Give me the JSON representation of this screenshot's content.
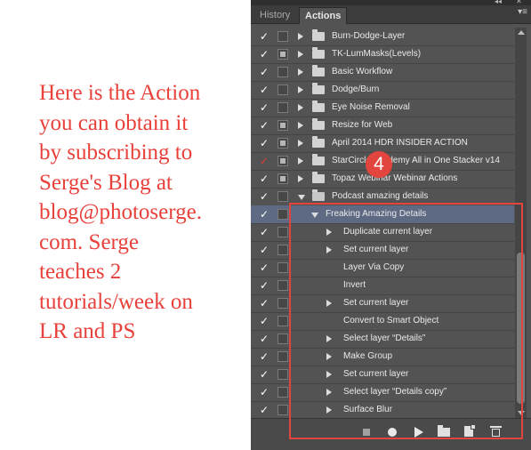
{
  "caption": {
    "lines": [
      "Here is the Action",
      "you can obtain it",
      "by subscribing to",
      "Serge's Blog at",
      "blog@photoserge.",
      "com.  Serge",
      "teaches 2",
      "tutorials/week on",
      "LR and PS"
    ]
  },
  "panel": {
    "collapse_glyph": "◂◂",
    "close_glyph": "✕",
    "tabs": [
      {
        "label": "History",
        "active": false
      },
      {
        "label": "Actions",
        "active": true
      }
    ],
    "menu_glyph": "▾≡"
  },
  "actions": [
    {
      "label": "Burn-Dodge-Layer",
      "check": "✓",
      "dialog": false,
      "type": "set",
      "expanded": false
    },
    {
      "label": "TK-LumMasks(Levels)",
      "check": "✓",
      "dialog": true,
      "type": "set",
      "expanded": false
    },
    {
      "label": "Basic Workflow",
      "check": "✓",
      "dialog": false,
      "type": "set",
      "expanded": false
    },
    {
      "label": "Dodge/Burn",
      "check": "✓",
      "dialog": false,
      "type": "set",
      "expanded": false
    },
    {
      "label": "Eye Noise Removal",
      "check": "✓",
      "dialog": false,
      "type": "set",
      "expanded": false
    },
    {
      "label": "Resize for Web",
      "check": "✓",
      "dialog": true,
      "type": "set",
      "expanded": false
    },
    {
      "label": "April 2014 HDR INSIDER ACTION",
      "check": "✓",
      "dialog": true,
      "type": "set",
      "expanded": false
    },
    {
      "label": "StarCircle Academy All in One Stacker v14",
      "check": "✓",
      "check_color": "red",
      "dialog": true,
      "type": "set",
      "expanded": false
    },
    {
      "label": "Topaz Webinar Webinar Actions",
      "check": "✓",
      "dialog": true,
      "type": "set",
      "expanded": false
    },
    {
      "label": "Podcast amazing details",
      "check": "✓",
      "dialog": false,
      "type": "set",
      "expanded": true
    },
    {
      "label": "Freaking Amazing Details",
      "check": "✓",
      "dialog": false,
      "type": "action",
      "expanded": true,
      "selected": true
    },
    {
      "label": "Duplicate current layer",
      "check": "✓",
      "dialog": false,
      "type": "step",
      "expandable": true
    },
    {
      "label": "Set current layer",
      "check": "✓",
      "dialog": false,
      "type": "step",
      "expandable": true
    },
    {
      "label": "Layer Via Copy",
      "check": "✓",
      "dialog": false,
      "type": "step",
      "expandable": false
    },
    {
      "label": "Invert",
      "check": "✓",
      "dialog": false,
      "type": "step",
      "expandable": false
    },
    {
      "label": "Set current layer",
      "check": "✓",
      "dialog": false,
      "type": "step",
      "expandable": true
    },
    {
      "label": "Convert to Smart Object",
      "check": "✓",
      "dialog": false,
      "type": "step",
      "expandable": false
    },
    {
      "label": "Select layer “Details”",
      "check": "✓",
      "dialog": false,
      "type": "step",
      "expandable": true
    },
    {
      "label": "Make Group",
      "check": "✓",
      "dialog": false,
      "type": "step",
      "expandable": true
    },
    {
      "label": "Set current layer",
      "check": "✓",
      "dialog": false,
      "type": "step",
      "expandable": true
    },
    {
      "label": "Select layer “Details copy”",
      "check": "✓",
      "dialog": false,
      "type": "step",
      "expandable": true
    },
    {
      "label": "Surface Blur",
      "check": "✓",
      "dialog": false,
      "type": "step",
      "expandable": true
    }
  ],
  "toolbar": {
    "icons": [
      "stop-icon",
      "record-icon",
      "play-icon",
      "new-set-icon",
      "new-action-icon",
      "delete-icon"
    ]
  },
  "annotation": {
    "step_number": "4",
    "color": "#e2453d"
  }
}
